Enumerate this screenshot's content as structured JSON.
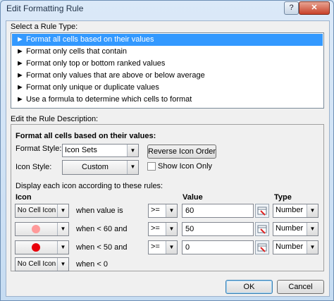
{
  "window": {
    "title": "Edit Formatting Rule",
    "help_label": "?",
    "close_label": "✕"
  },
  "rule_type": {
    "label": "Select a Rule Type:",
    "items": [
      "► Format all cells based on their values",
      "► Format only cells that contain",
      "► Format only top or bottom ranked values",
      "► Format only values that are above or below average",
      "► Format only unique or duplicate values",
      "► Use a formula to determine which cells to format"
    ],
    "selected_index": 0
  },
  "description": {
    "label": "Edit the Rule Description:",
    "heading": "Format all cells based on their values:",
    "format_style_label": "Format Style:",
    "format_style_value": "Icon Sets",
    "reverse_label": "Reverse Icon Order",
    "icon_style_label": "Icon Style:",
    "icon_style_value": "Custom",
    "show_icon_only_label": "Show Icon Only",
    "show_icon_only_checked": false,
    "display_text": "Display each icon according to these rules:",
    "col_icon": "Icon",
    "col_value": "Value",
    "col_type": "Type"
  },
  "rules": [
    {
      "icon": "No Cell Icon",
      "text": "when value is",
      "operator": ">=",
      "value": "60",
      "type": "Number"
    },
    {
      "icon": "light-red-circle-icon",
      "icon_color": "#ff9a9a",
      "text": "when < 60 and",
      "operator": ">=",
      "value": "50",
      "type": "Number"
    },
    {
      "icon": "red-circle-icon",
      "icon_color": "#e8000b",
      "text": "when < 50 and",
      "operator": ">=",
      "value": "0",
      "type": "Number"
    },
    {
      "icon": "No Cell Icon",
      "text": "when < 0"
    }
  ],
  "footer": {
    "ok_label": "OK",
    "cancel_label": "Cancel"
  }
}
